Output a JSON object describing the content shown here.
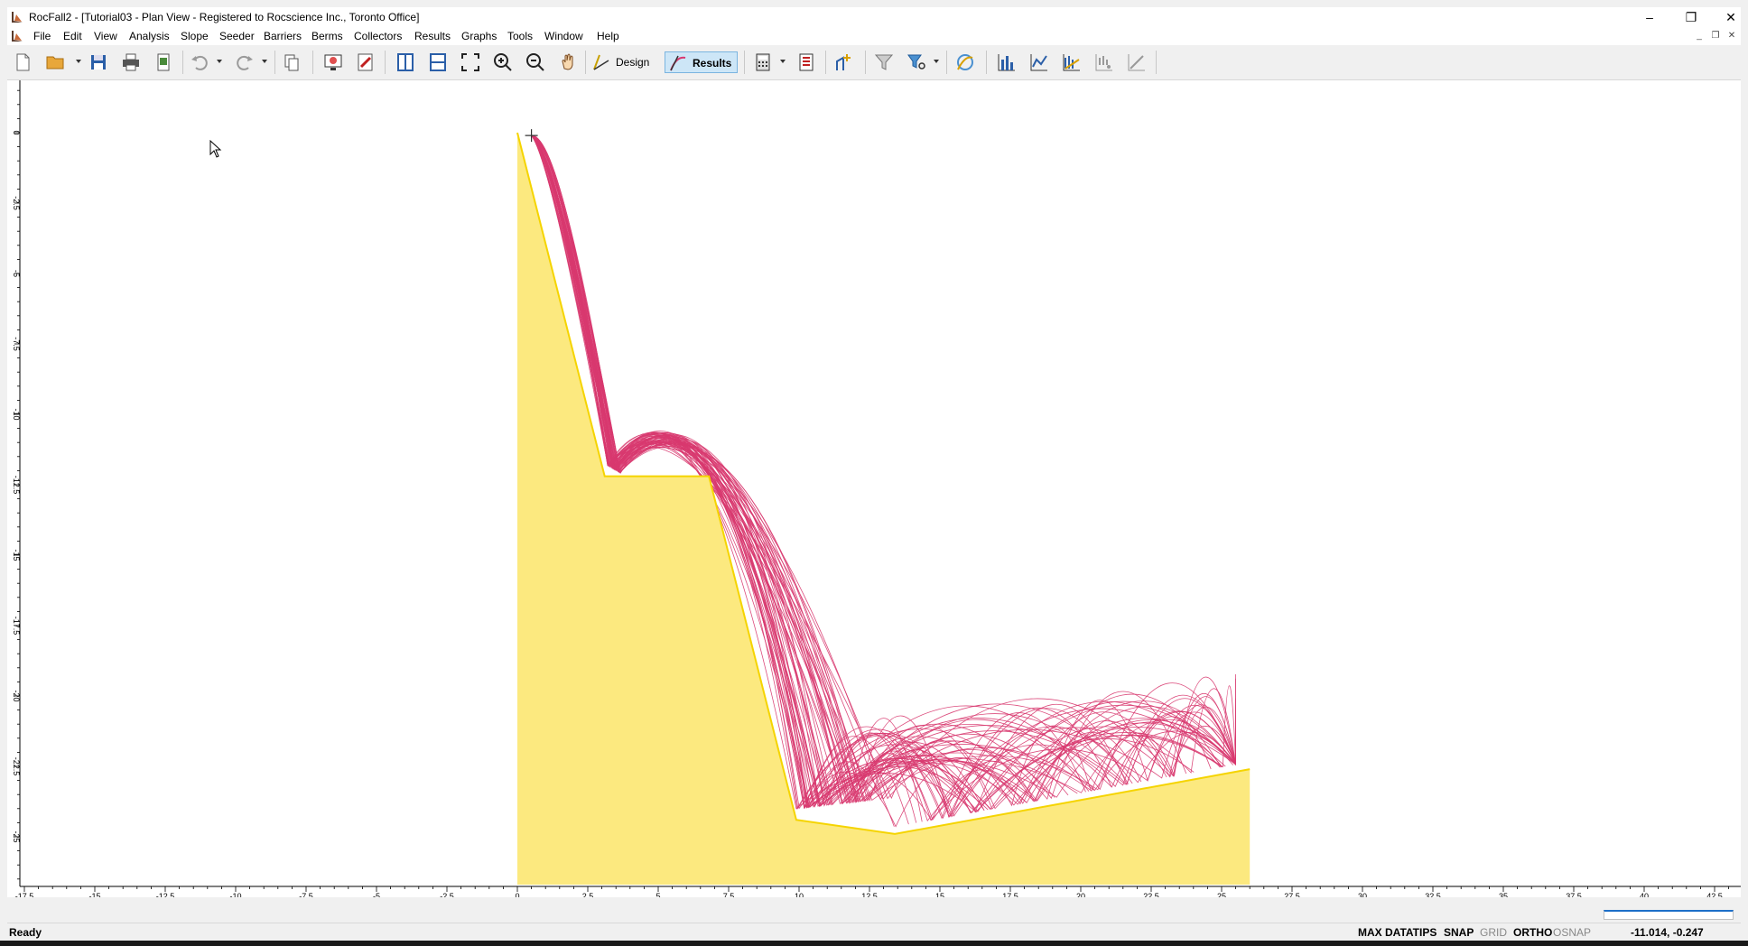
{
  "window": {
    "title": "RocFall2 - [Tutorial03 - Plan View - Registered to Rocscience Inc., Toronto Office]",
    "minimize": "–",
    "restore": "❐",
    "close": "✕"
  },
  "menu": {
    "items": [
      "File",
      "Edit",
      "View",
      "Analysis",
      "Slope",
      "Seeder",
      "Barriers",
      "Berms",
      "Collectors",
      "Results",
      "Graphs",
      "Tools",
      "Window",
      "Help"
    ],
    "mdi_minimize": "_",
    "mdi_restore": "❐",
    "mdi_close": "✕"
  },
  "toolbar": {
    "design_label": "Design",
    "results_label": "Results"
  },
  "colors": {
    "slope_fill": "#fce97f",
    "slope_edge": "#f5d400",
    "trajectory": "#d8386f",
    "axis": "#000000"
  },
  "plot": {
    "x_ticks": [
      "-17.5",
      "-15",
      "-12.5",
      "-10",
      "-7.5",
      "-5",
      "-2.5",
      "0",
      "2.5",
      "5",
      "7.5",
      "10",
      "12.5",
      "15",
      "17.5",
      "20",
      "22.5",
      "25",
      "27.5",
      "30",
      "32.5",
      "35",
      "37.5",
      "40",
      "42.5"
    ],
    "y_ticks": [
      "0",
      "-2.5",
      "-5",
      "-7.5",
      "-10",
      "-12.5",
      "-15",
      "-17.5",
      "-20",
      "-22.5",
      "-25"
    ],
    "slope_profile": [
      [
        0,
        0
      ],
      [
        3.1,
        -12.2
      ],
      [
        6.8,
        -12.2
      ],
      [
        9.9,
        -24.4
      ],
      [
        13.4,
        -24.9
      ],
      [
        26.0,
        -22.6
      ]
    ],
    "seeder_point": [
      0.5,
      -0.1
    ]
  },
  "status": {
    "ready": "Ready",
    "max_datatips": "MAX DATATIPS",
    "snap": "SNAP",
    "grid": "GRID",
    "ortho": "ORTHO",
    "osnap": "OSNAP",
    "coords": "-11.014,  -0.247"
  }
}
